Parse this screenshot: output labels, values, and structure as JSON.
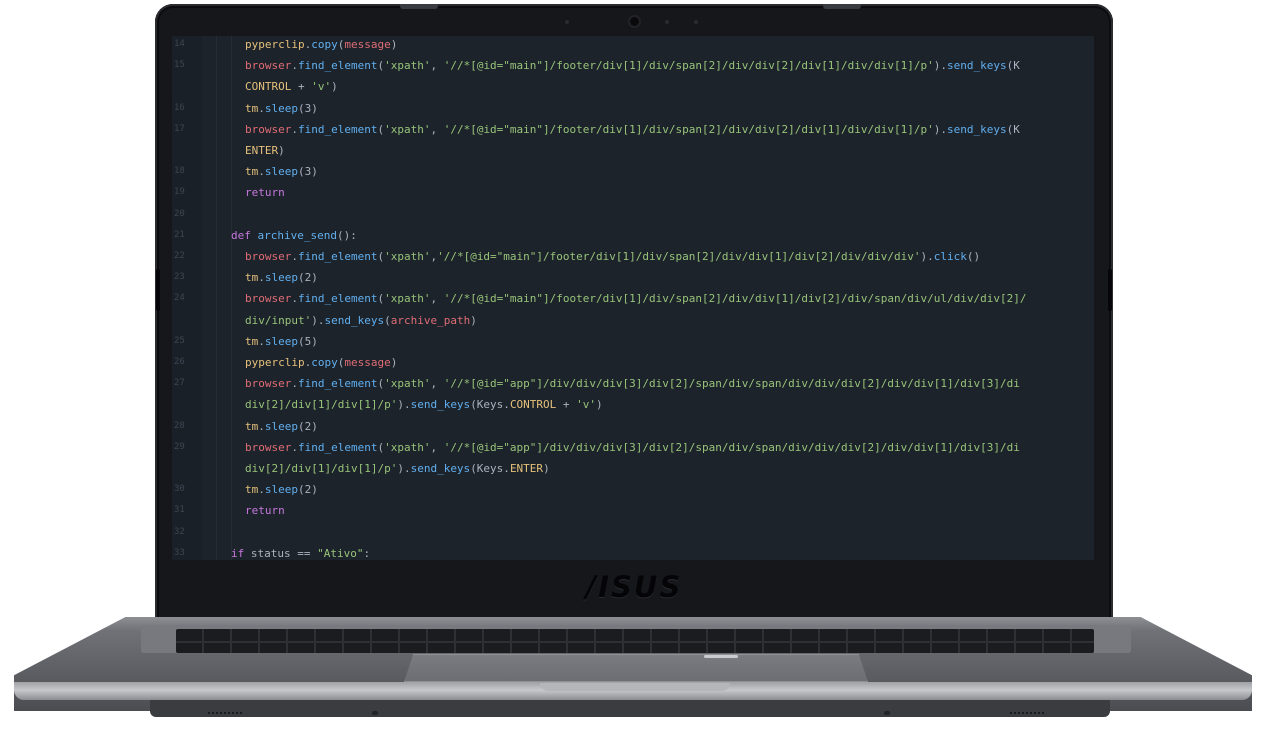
{
  "device": {
    "brand_logo": "/ISUS"
  },
  "editor": {
    "lines": [
      {
        "num": "14",
        "indent": 2,
        "tokens": [
          [
            "var",
            "pyperclip"
          ],
          [
            "plain",
            "."
          ],
          [
            "fn",
            "copy"
          ],
          [
            "plain",
            "("
          ],
          [
            "call",
            "message"
          ],
          [
            "plain",
            ")"
          ]
        ]
      },
      {
        "num": "15",
        "indent": 2,
        "tokens": [
          [
            "call",
            "browser"
          ],
          [
            "plain",
            "."
          ],
          [
            "fn",
            "find_element"
          ],
          [
            "plain",
            "("
          ],
          [
            "str",
            "'xpath'"
          ],
          [
            "plain",
            ", "
          ],
          [
            "str",
            "'//*[@id=\"main\"]/footer/div[1]/div/span[2]/div/div[2]/div[1]/div/div[1]/p'"
          ],
          [
            "plain",
            ")."
          ],
          [
            "fn",
            "send_keys"
          ],
          [
            "plain",
            "(K"
          ]
        ]
      },
      {
        "num": "",
        "indent": 2,
        "tokens": [
          [
            "var",
            "CONTROL"
          ],
          [
            "plain",
            " + "
          ],
          [
            "str",
            "'v'"
          ],
          [
            "plain",
            ")"
          ]
        ]
      },
      {
        "num": "16",
        "indent": 2,
        "tokens": [
          [
            "var",
            "tm"
          ],
          [
            "plain",
            "."
          ],
          [
            "fn",
            "sleep"
          ],
          [
            "plain",
            "(3)"
          ]
        ]
      },
      {
        "num": "17",
        "indent": 2,
        "tokens": [
          [
            "call",
            "browser"
          ],
          [
            "plain",
            "."
          ],
          [
            "fn",
            "find_element"
          ],
          [
            "plain",
            "("
          ],
          [
            "str",
            "'xpath'"
          ],
          [
            "plain",
            ", "
          ],
          [
            "str",
            "'//*[@id=\"main\"]/footer/div[1]/div/span[2]/div/div[2]/div[1]/div/div[1]/p'"
          ],
          [
            "plain",
            ")."
          ],
          [
            "fn",
            "send_keys"
          ],
          [
            "plain",
            "(K"
          ]
        ]
      },
      {
        "num": "",
        "indent": 2,
        "tokens": [
          [
            "var",
            "ENTER"
          ],
          [
            "plain",
            ")"
          ]
        ]
      },
      {
        "num": "18",
        "indent": 2,
        "tokens": [
          [
            "var",
            "tm"
          ],
          [
            "plain",
            "."
          ],
          [
            "fn",
            "sleep"
          ],
          [
            "plain",
            "(3)"
          ]
        ]
      },
      {
        "num": "19",
        "indent": 2,
        "tokens": [
          [
            "ret",
            "return"
          ]
        ]
      },
      {
        "num": "20",
        "indent": 0,
        "tokens": []
      },
      {
        "num": "21",
        "indent": 1,
        "tokens": [
          [
            "def",
            "def "
          ],
          [
            "fn",
            "archive_send"
          ],
          [
            "plain",
            "():"
          ]
        ]
      },
      {
        "num": "22",
        "indent": 2,
        "tokens": [
          [
            "call",
            "browser"
          ],
          [
            "plain",
            "."
          ],
          [
            "fn",
            "find_element"
          ],
          [
            "plain",
            "("
          ],
          [
            "str",
            "'xpath'"
          ],
          [
            "plain",
            ","
          ],
          [
            "str",
            "'//*[@id=\"main\"]/footer/div[1]/div/span[2]/div/div[1]/div[2]/div/div/div'"
          ],
          [
            "plain",
            ")."
          ],
          [
            "fn",
            "click"
          ],
          [
            "plain",
            "()"
          ]
        ]
      },
      {
        "num": "23",
        "indent": 2,
        "tokens": [
          [
            "var",
            "tm"
          ],
          [
            "plain",
            "."
          ],
          [
            "fn",
            "sleep"
          ],
          [
            "plain",
            "(2)"
          ]
        ]
      },
      {
        "num": "24",
        "indent": 2,
        "tokens": [
          [
            "call",
            "browser"
          ],
          [
            "plain",
            "."
          ],
          [
            "fn",
            "find_element"
          ],
          [
            "plain",
            "("
          ],
          [
            "str",
            "'xpath'"
          ],
          [
            "plain",
            ", "
          ],
          [
            "str",
            "'//*[@id=\"main\"]/footer/div[1]/div/span[2]/div/div[1]/div[2]/div/span/div/ul/div/div[2]/"
          ]
        ]
      },
      {
        "num": "",
        "indent": 2,
        "tokens": [
          [
            "str",
            "div/input'"
          ],
          [
            "plain",
            ")."
          ],
          [
            "fn",
            "send_keys"
          ],
          [
            "plain",
            "("
          ],
          [
            "call",
            "archive_path"
          ],
          [
            "plain",
            ")"
          ]
        ]
      },
      {
        "num": "25",
        "indent": 2,
        "tokens": [
          [
            "var",
            "tm"
          ],
          [
            "plain",
            "."
          ],
          [
            "fn",
            "sleep"
          ],
          [
            "plain",
            "(5)"
          ]
        ]
      },
      {
        "num": "26",
        "indent": 2,
        "tokens": [
          [
            "var",
            "pyperclip"
          ],
          [
            "plain",
            "."
          ],
          [
            "fn",
            "copy"
          ],
          [
            "plain",
            "("
          ],
          [
            "call",
            "message"
          ],
          [
            "plain",
            ")"
          ]
        ]
      },
      {
        "num": "27",
        "indent": 2,
        "tokens": [
          [
            "call",
            "browser"
          ],
          [
            "plain",
            "."
          ],
          [
            "fn",
            "find_element"
          ],
          [
            "plain",
            "("
          ],
          [
            "str",
            "'xpath'"
          ],
          [
            "plain",
            ", "
          ],
          [
            "str",
            "'//*[@id=\"app\"]/div/div/div[3]/div[2]/span/div/span/div/div/div[2]/div/div[1]/div[3]/di"
          ]
        ]
      },
      {
        "num": "",
        "indent": 2,
        "tokens": [
          [
            "str",
            "div[2]/div[1]/div[1]/p'"
          ],
          [
            "plain",
            ")."
          ],
          [
            "fn",
            "send_keys"
          ],
          [
            "plain",
            "(Keys."
          ],
          [
            "var",
            "CONTROL"
          ],
          [
            "plain",
            " + "
          ],
          [
            "str",
            "'v'"
          ],
          [
            "plain",
            ")"
          ]
        ]
      },
      {
        "num": "28",
        "indent": 2,
        "tokens": [
          [
            "var",
            "tm"
          ],
          [
            "plain",
            "."
          ],
          [
            "fn",
            "sleep"
          ],
          [
            "plain",
            "(2)"
          ]
        ]
      },
      {
        "num": "29",
        "indent": 2,
        "tokens": [
          [
            "call",
            "browser"
          ],
          [
            "plain",
            "."
          ],
          [
            "fn",
            "find_element"
          ],
          [
            "plain",
            "("
          ],
          [
            "str",
            "'xpath'"
          ],
          [
            "plain",
            ", "
          ],
          [
            "str",
            "'//*[@id=\"app\"]/div/div/div[3]/div[2]/span/div/span/div/div/div[2]/div/div[1]/div[3]/di"
          ]
        ]
      },
      {
        "num": "",
        "indent": 2,
        "tokens": [
          [
            "str",
            "div[2]/div[1]/div[1]/p'"
          ],
          [
            "plain",
            ")."
          ],
          [
            "fn",
            "send_keys"
          ],
          [
            "plain",
            "(Keys."
          ],
          [
            "var",
            "ENTER"
          ],
          [
            "plain",
            ")"
          ]
        ]
      },
      {
        "num": "30",
        "indent": 2,
        "tokens": [
          [
            "var",
            "tm"
          ],
          [
            "plain",
            "."
          ],
          [
            "fn",
            "sleep"
          ],
          [
            "plain",
            "(2)"
          ]
        ]
      },
      {
        "num": "31",
        "indent": 2,
        "tokens": [
          [
            "ret",
            "return"
          ]
        ]
      },
      {
        "num": "32",
        "indent": 0,
        "tokens": []
      },
      {
        "num": "33",
        "indent": 1,
        "tokens": [
          [
            "kw",
            "if "
          ],
          [
            "plain",
            "status == "
          ],
          [
            "str",
            "\"Ativo\""
          ],
          [
            "plain",
            ":"
          ]
        ]
      }
    ]
  }
}
